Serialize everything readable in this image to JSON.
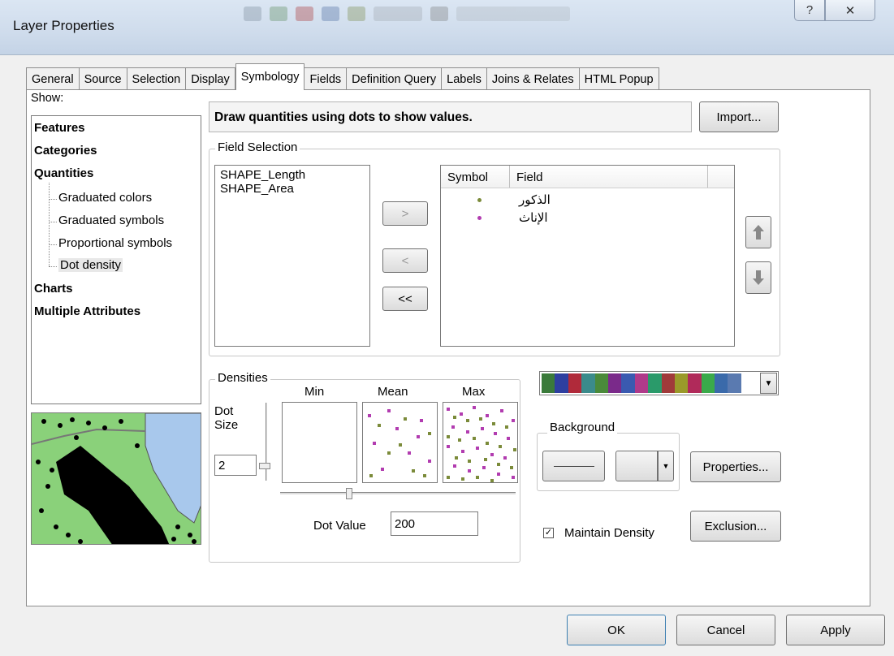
{
  "window": {
    "title": "Layer Properties",
    "help_icon": "?",
    "close_icon": "✕"
  },
  "tabs": [
    "General",
    "Source",
    "Selection",
    "Display",
    "Symbology",
    "Fields",
    "Definition Query",
    "Labels",
    "Joins & Relates",
    "HTML Popup"
  ],
  "active_tab": "Symbology",
  "show": {
    "label": "Show:",
    "items": {
      "features": "Features",
      "categories": "Categories",
      "quantities": "Quantities",
      "graduated_colors": "Graduated colors",
      "graduated_symbols": "Graduated symbols",
      "proportional_symbols": "Proportional symbols",
      "dot_density": "Dot density",
      "charts": "Charts",
      "multiple_attributes": "Multiple Attributes"
    },
    "selected": "Dot density"
  },
  "description": "Draw quantities using dots to show values.",
  "import_button": "Import...",
  "field_selection": {
    "title": "Field Selection",
    "available_fields": [
      "SHAPE_Length",
      "SHAPE_Area"
    ],
    "move_right": ">",
    "move_left": "<",
    "move_all_left": "<<",
    "table_headers": {
      "symbol": "Symbol",
      "field": "Field"
    },
    "selected_fields": [
      {
        "field": "الذكور",
        "color": "#7b8b3a"
      },
      {
        "field": "الإناث",
        "color": "#b23cb0"
      }
    ]
  },
  "densities": {
    "title": "Densities",
    "dot_size_label": "Dot Size",
    "dot_size_value": "2",
    "min_label": "Min",
    "mean_label": "Mean",
    "max_label": "Max",
    "dot_value_label": "Dot Value",
    "dot_value": "200"
  },
  "color_ramp": [
    "#3a7a3a",
    "#2e3fa0",
    "#b02a3a",
    "#3b8b8b",
    "#4a8a3a",
    "#7a2a8a",
    "#3a5ab0",
    "#b03a8a",
    "#2a9a6a",
    "#a03a3a",
    "#9a9a2a",
    "#b02a5a",
    "#3aaa4a",
    "#3a6aaa",
    "#5a7ab0"
  ],
  "background": {
    "title": "Background"
  },
  "properties_button": "Properties...",
  "maintain_density": {
    "label": "Maintain Density",
    "checked": true,
    "check_mark": "✓"
  },
  "exclusion_button": "Exclusion...",
  "footer": {
    "ok": "OK",
    "cancel": "Cancel",
    "apply": "Apply"
  }
}
